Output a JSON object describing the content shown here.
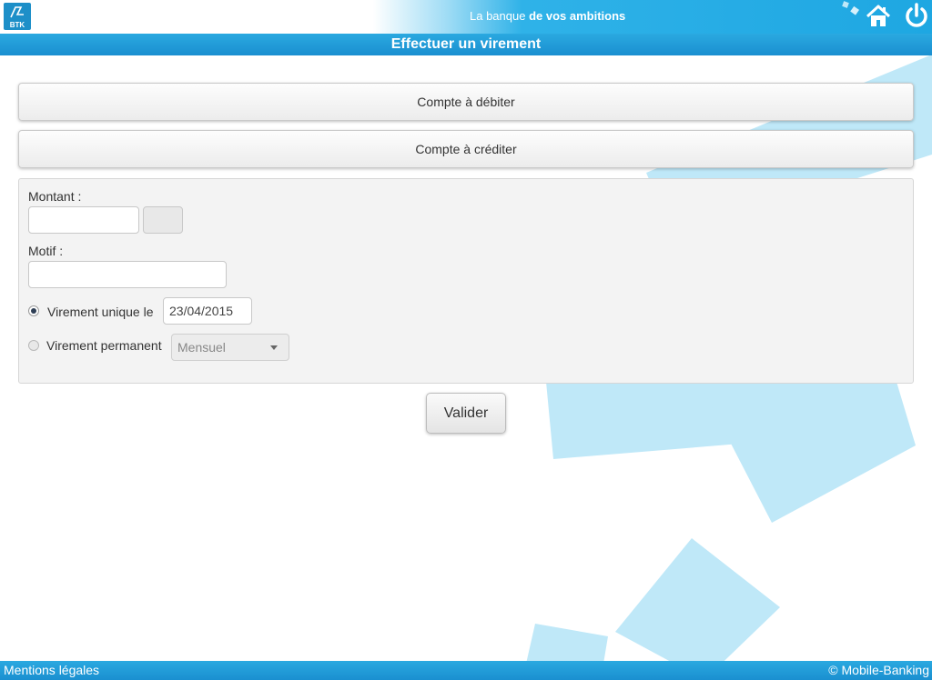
{
  "header": {
    "logo_text": "BTK",
    "tagline_prefix": "La banque ",
    "tagline_bold": "de vos ambitions",
    "home_icon": "home-icon",
    "power_icon": "power-icon",
    "accent_color": "#1ea7e2"
  },
  "page": {
    "title": "Effectuer un virement"
  },
  "accounts": {
    "debit_label": "Compte à débiter",
    "credit_label": "Compte à créditer"
  },
  "form": {
    "amount_label": "Montant :",
    "amount_value": "",
    "reason_label": "Motif :",
    "reason_value": "",
    "single_transfer_label": "Virement unique le",
    "single_transfer_selected": true,
    "date_value": "23/04/2015",
    "permanent_transfer_label": "Virement permanent",
    "permanent_transfer_selected": false,
    "frequency_value": "Mensuel"
  },
  "actions": {
    "validate_label": "Valider"
  },
  "footer": {
    "legal_label": "Mentions légales",
    "copyright": "© Mobile-Banking"
  }
}
